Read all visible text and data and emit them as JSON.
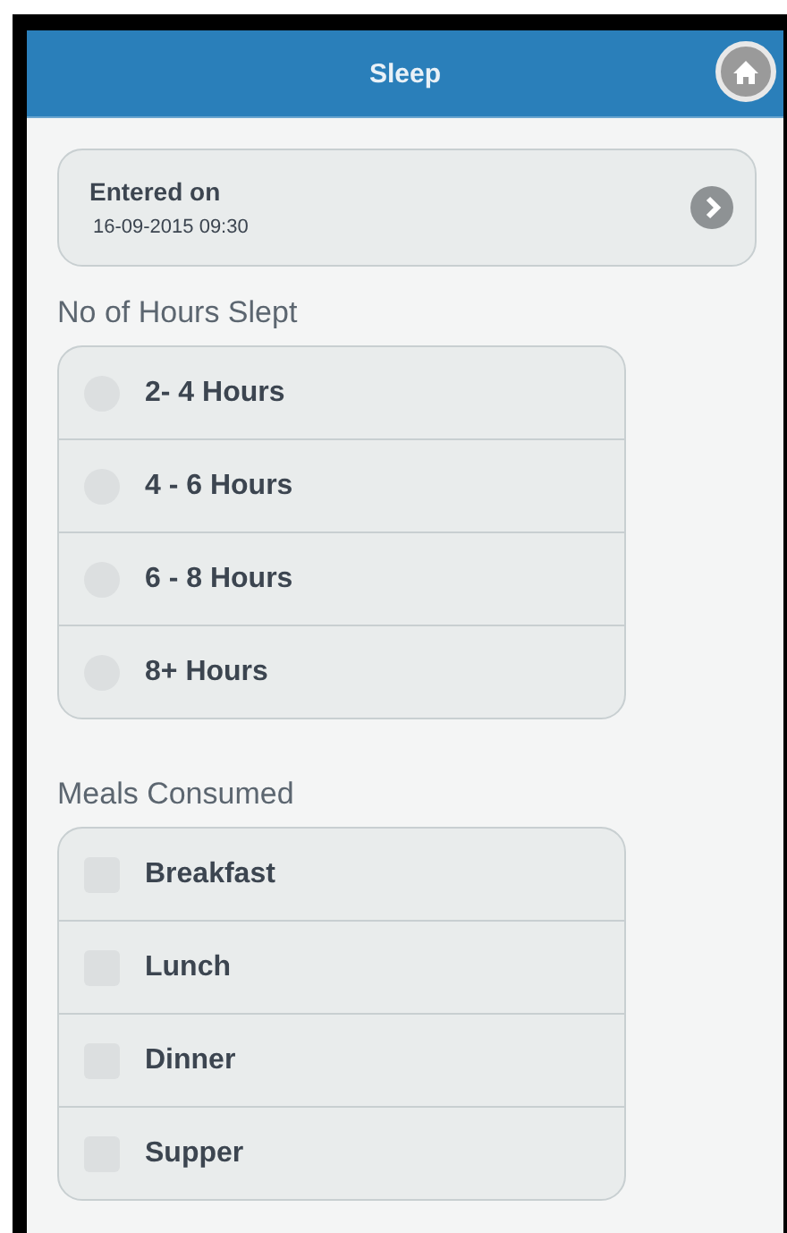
{
  "header": {
    "title": "Sleep"
  },
  "entry": {
    "label": "Entered on",
    "value": "16-09-2015 09:30"
  },
  "hours": {
    "label": "No of Hours Slept",
    "options": [
      {
        "label": "2- 4 Hours",
        "selected": false
      },
      {
        "label": "4 - 6 Hours",
        "selected": false
      },
      {
        "label": "6 - 8 Hours",
        "selected": false
      },
      {
        "label": "8+ Hours",
        "selected": false
      }
    ]
  },
  "meals": {
    "label": "Meals Consumed",
    "options": [
      {
        "label": "Breakfast",
        "checked": false
      },
      {
        "label": "Lunch",
        "checked": false
      },
      {
        "label": "Dinner",
        "checked": false
      },
      {
        "label": "Supper",
        "checked": false
      }
    ]
  }
}
